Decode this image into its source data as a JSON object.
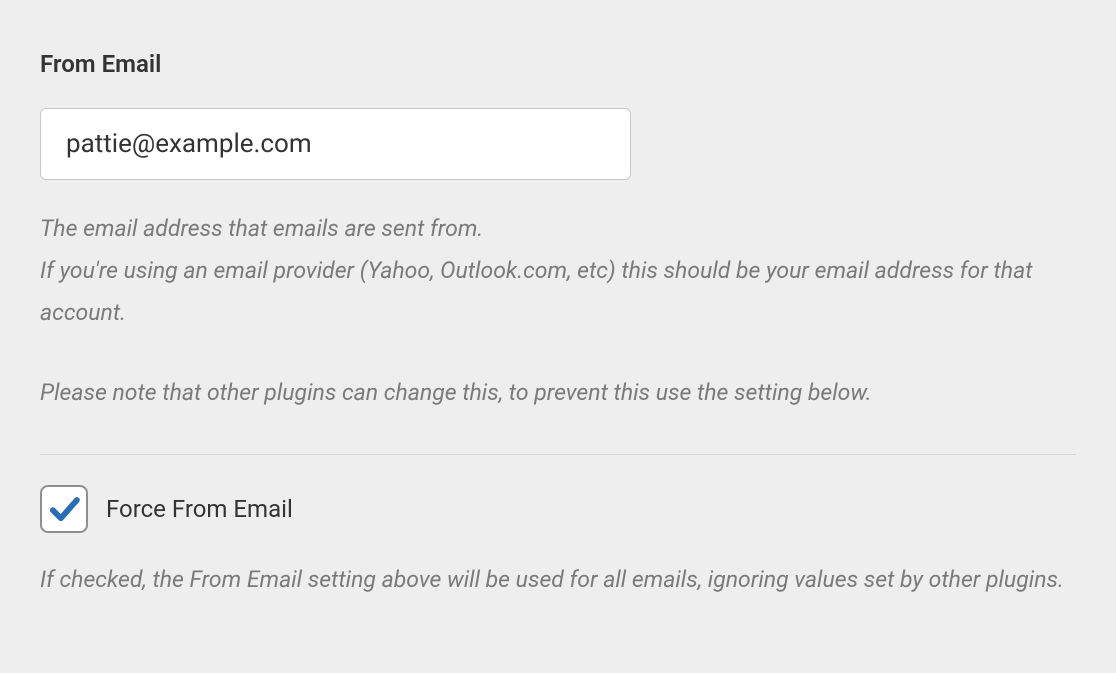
{
  "from_email": {
    "label": "From Email",
    "value": "pattie@example.com",
    "description_line1": "The email address that emails are sent from.",
    "description_line2": "If you're using an email provider (Yahoo, Outlook.com, etc) this should be your email address for that account.",
    "description_line3": "Please note that other plugins can change this, to prevent this use the setting below."
  },
  "force_from_email": {
    "label": "Force From Email",
    "checked": true,
    "description": "If checked, the From Email setting above will be used for all emails, ignoring values set by other plugins."
  }
}
